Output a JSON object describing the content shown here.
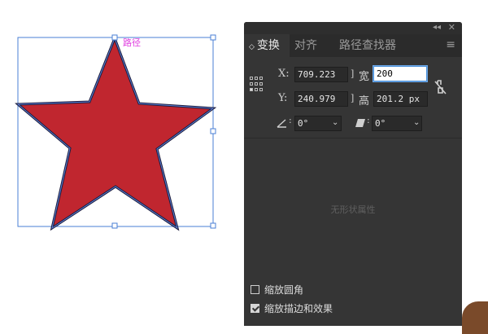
{
  "artwork": {
    "path_label": "路径",
    "fill_color": "#c0262f",
    "stroke_color": "#1b1b3a",
    "selection_color": "#4a7fd4"
  },
  "panel": {
    "tabs": [
      {
        "label": "变换",
        "active": true
      },
      {
        "label": "对齐",
        "active": false
      },
      {
        "label": "路径查找器",
        "active": false
      }
    ],
    "tab_arrow": "◇",
    "collapse_icon": "◂◂",
    "close_icon": "✕",
    "menu_icon": "≡",
    "x_label": "X:",
    "x_value": "709.223 ",
    "y_label": "Y:",
    "y_value": "240.979 ",
    "width_label": "宽 :",
    "width_value": "200",
    "height_label": "高 :",
    "height_value": "201.2 px",
    "rotate_value": "0°",
    "shear_value": "0°",
    "empty_message": "无形状属性",
    "scale_corners_label": "缩放圆角",
    "scale_corners_checked": false,
    "scale_strokes_label": "缩放描边和效果",
    "scale_strokes_checked": true
  }
}
